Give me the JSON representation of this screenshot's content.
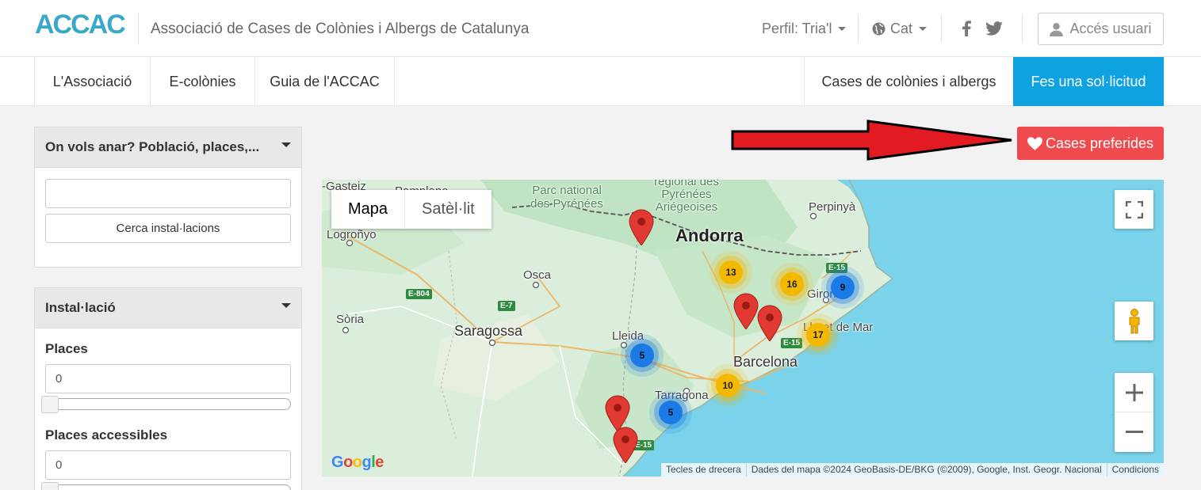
{
  "header": {
    "logo_text": "ACCAC",
    "org_name": "Associació de Cases de Colònies i Albergs de Catalunya",
    "profile_label": "Perfil: Tria'l",
    "language_label": "Cat",
    "facebook_icon": "facebook-icon",
    "twitter_icon": "twitter-icon",
    "login_label": "Accés usuari"
  },
  "nav": {
    "items": [
      "L'Associació",
      "E-colònies",
      "Guia de l'ACCAC"
    ],
    "houses_label": "Cases de colònies i albergs",
    "request_label": "Fes una sol·licitud"
  },
  "search_panel": {
    "title": "On vols anar? Població, places,...",
    "input_value": "",
    "button_label": "Cerca instal·lacions"
  },
  "install_panel": {
    "title": "Instal·lació",
    "places_label": "Places",
    "places_value": "0",
    "accessible_label": "Places accessibles",
    "accessible_value": "0"
  },
  "favorites": {
    "label": "Cases preferides"
  },
  "map": {
    "type_map": "Mapa",
    "type_satellite": "Satèl·lit",
    "labels": {
      "andorra": "Andorra",
      "saragossa": "Saragossa",
      "barcelona": "Barcelona",
      "lleida": "Lleida",
      "tarragona": "Tarragona",
      "osca": "Osca",
      "logronyo": "Logroñyo",
      "soria": "Sòria",
      "perpinya": "Perpinyà",
      "girona": "Girona",
      "lloret": "Lloret de Mar",
      "gasteiz": "-Gasteiz",
      "pamplona": "Pamplona",
      "parc_pyrenees": "Parc national des Pyrénées",
      "parc_ariegeoises": "régional des Pyrénées Ariégeoises"
    },
    "roads": [
      "E-804",
      "E-7",
      "E-15",
      "E-15",
      "E-15"
    ],
    "clusters": [
      {
        "count": "13",
        "color": "yellow"
      },
      {
        "count": "16",
        "color": "yellow"
      },
      {
        "count": "9",
        "color": "blue"
      },
      {
        "count": "17",
        "color": "yellow"
      },
      {
        "count": "5",
        "color": "blue"
      },
      {
        "count": "10",
        "color": "yellow"
      },
      {
        "count": "5",
        "color": "blue"
      }
    ],
    "attribution": {
      "shortcuts": "Tecles de drecera",
      "data": "Dades del mapa ©2024 GeoBasis-DE/BKG (©2009), Google, Inst. Geogr. Nacional",
      "terms": "Condicions"
    },
    "google_logo": "Google"
  },
  "colors": {
    "accent": "#0ea3e0",
    "favorites": "#ef4b4f",
    "logo": "#3aa8c8",
    "cluster_yellow": "#f5b800",
    "cluster_blue": "#1a7ae6",
    "pin_red": "#e03a32",
    "sea": "#7ad3ea"
  }
}
